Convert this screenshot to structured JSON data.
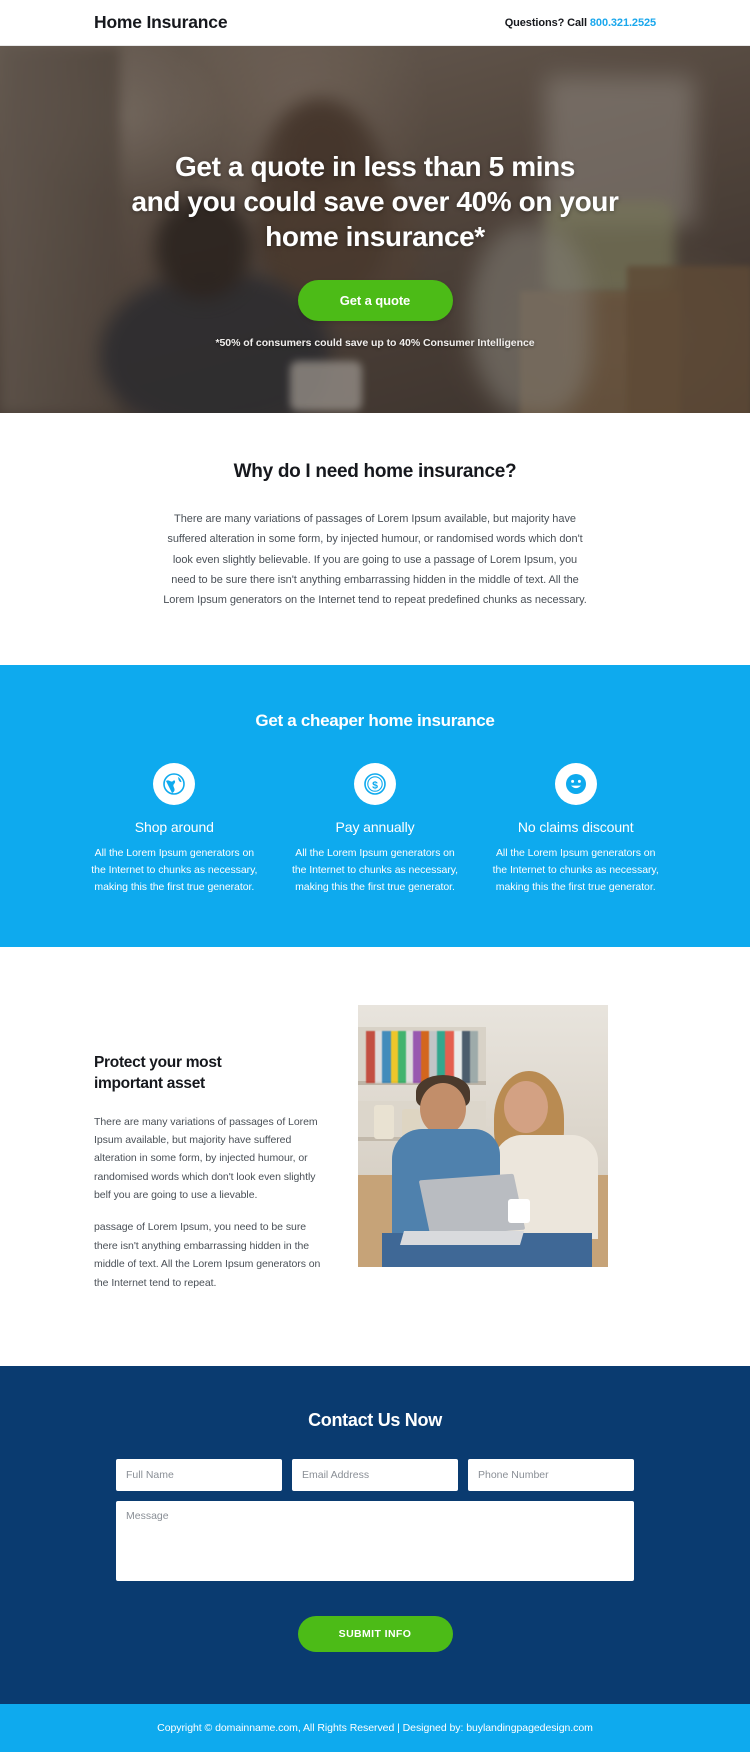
{
  "header": {
    "brand": "Home Insurance",
    "contact_prefix": "Questions? Call ",
    "phone": "800.321.2525"
  },
  "hero": {
    "title_line1": "Get a quote in less than 5 mins",
    "title_line2": "and you could save over 40% on your",
    "title_line3": "home insurance*",
    "cta_label": "Get a quote",
    "disclaimer": "*50% of consumers could save up to 40% Consumer Intelligence"
  },
  "why": {
    "title": "Why do I need home insurance?",
    "body": "There are many variations of passages of Lorem Ipsum available, but majority have suffered alteration in some form, by injected humour, or randomised words which don't look even slightly believable. If you are going to use a passage of Lorem Ipsum, you need to be sure there isn't anything embarrassing hidden in the middle of text. All the Lorem Ipsum generators on the Internet tend to repeat predefined chunks as necessary."
  },
  "features": {
    "title": "Get a cheaper home insurance",
    "items": [
      {
        "icon": "globe-icon",
        "name": "Shop around",
        "text": "All the Lorem Ipsum generators on the Internet to chunks as necessary, making this the first true generator."
      },
      {
        "icon": "dollar-coin-icon",
        "name": "Pay annually",
        "text": "All the Lorem Ipsum generators on the Internet to chunks as necessary, making this the first true generator."
      },
      {
        "icon": "smiley-face-icon",
        "name": "No claims discount",
        "text": "All the Lorem Ipsum generators on the Internet to chunks as necessary, making this the first true generator."
      }
    ]
  },
  "protect": {
    "title_line1": "Protect your most",
    "title_line2": "important asset",
    "paragraph1": "There are many variations of passages of Lorem Ipsum available, but majority have suffered alteration in some form, by injected humour, or randomised words which don't look even slightly belf you are going to use a lievable.",
    "paragraph2": "passage of Lorem Ipsum, you need to be sure there isn't anything embarrassing hidden in the middle of text. All the Lorem Ipsum generators on the Internet tend to repeat."
  },
  "contact": {
    "title": "Contact Us Now",
    "fields": {
      "full_name_placeholder": "Full Name",
      "email_placeholder": "Email Address",
      "phone_placeholder": "Phone Number",
      "message_placeholder": "Message"
    },
    "submit_label": "SUBMIT INFO"
  },
  "footer": {
    "text": "Copyright © domainname.com, All Rights Reserved | Designed by: buylandingpagedesign.com"
  },
  "colors": {
    "accent_blue": "#0eaaee",
    "green": "#4cbb17",
    "navy": "#0a3b70",
    "dark_text": "#16181d"
  }
}
